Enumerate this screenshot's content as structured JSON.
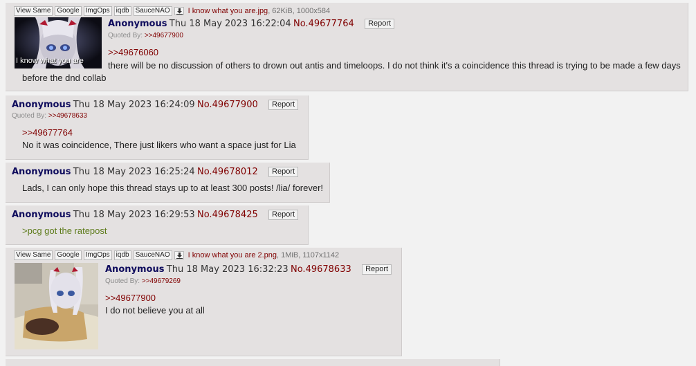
{
  "file_buttons": [
    "View Same",
    "Google",
    "ImgOps",
    "iqdb",
    "SauceNAO"
  ],
  "report_label": "Report",
  "quoted_by_label": "Quoted By:",
  "posts": [
    {
      "file": {
        "name": "I know what you are.jpg",
        "info": ", 62KiB, 1000x584"
      },
      "thumb_caption": "I know what you are",
      "name": "Anonymous",
      "date": "Thu 18 May 2023 16:22:04",
      "no": "No.49677764",
      "quoted_by": ">>49677900",
      "quote": ">>49676060",
      "text": "there will be no discussion of others to drown out antis and timeloops. I do not think it's a coincidence this thread is trying to be made a few days before the dnd collab"
    },
    {
      "name": "Anonymous",
      "date": "Thu 18 May 2023 16:24:09",
      "no": "No.49677900",
      "quoted_by": ">>49678633",
      "quote": ">>49677764",
      "text": "No it was coincidence, There just likers who want a space just for Lia"
    },
    {
      "name": "Anonymous",
      "date": "Thu 18 May 2023 16:25:24",
      "no": "No.49678012",
      "text": "Lads, I can only hope this thread stays up to at least 300 posts! /lia/ forever!"
    },
    {
      "name": "Anonymous",
      "date": "Thu 18 May 2023 16:29:53",
      "no": "No.49678425",
      "greentext": ">pcg got the ratepost"
    },
    {
      "file": {
        "name": "I know what you are 2.png",
        "info": ", 1MiB, 1107x1142"
      },
      "name": "Anonymous",
      "date": "Thu 18 May 2023 16:32:23",
      "no": "No.49678633",
      "quoted_by": ">>49679269",
      "quote": ">>49677900",
      "text": "I do not believe you at all"
    }
  ],
  "colors": {
    "background": "#f2f2f2",
    "post_background": "#e4e1e1",
    "name": "#0f0c5d",
    "post_number": "#800000",
    "quote_link": "#800000",
    "greentext": "#5d7b1a"
  }
}
